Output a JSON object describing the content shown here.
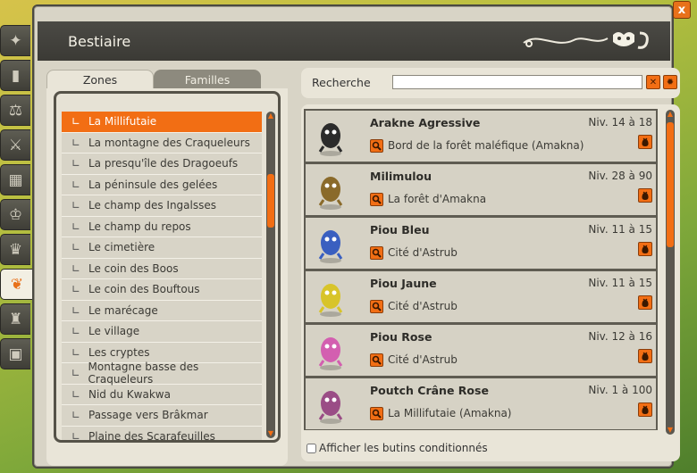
{
  "window": {
    "title": "Bestiaire",
    "close_label": "x"
  },
  "side_tabs": [
    {
      "icon": "wand-icon",
      "glyph": "✦"
    },
    {
      "icon": "book-icon",
      "glyph": "▮"
    },
    {
      "icon": "scales-icon",
      "glyph": "⚖"
    },
    {
      "icon": "crossed-axes-icon",
      "glyph": "⚔"
    },
    {
      "icon": "calendar-icon",
      "glyph": "▦"
    },
    {
      "icon": "trophy-icon",
      "glyph": "♔"
    },
    {
      "icon": "crown-icon",
      "glyph": "♛"
    },
    {
      "icon": "monster-head-icon",
      "glyph": "❦",
      "active": true
    },
    {
      "icon": "horned-helmet-icon",
      "glyph": "♜"
    },
    {
      "icon": "padlock-book-icon",
      "glyph": "▣"
    }
  ],
  "tabs": {
    "zones": "Zones",
    "families": "Familles"
  },
  "zones": [
    "La Millifutaie",
    "La montagne des Craqueleurs",
    "La presqu'île des Dragoeufs",
    "La péninsule des gelées",
    "Le champ des Ingalsses",
    "Le champ du repos",
    "Le cimetière",
    "Le coin des Boos",
    "Le coin des Bouftous",
    "Le marécage",
    "Le village",
    "Les cryptes",
    "Montagne basse des Craqueleurs",
    "Nid du Kwakwa",
    "Passage vers Brâkmar",
    "Plaine des Scarafeuilles"
  ],
  "selected_zone": 0,
  "search": {
    "label": "Recherche",
    "value": "",
    "clear_icon": "close-icon",
    "settings_icon": "gear-icon"
  },
  "monsters": [
    {
      "name": "Arakne Agressive",
      "level": "Niv. 14 à 18",
      "location": "Bord de la forêt maléfique (Amakna)",
      "color": "#2b2b2b"
    },
    {
      "name": "Milimulou",
      "level": "Niv. 28 à 90",
      "location": "La forêt d'Amakna",
      "color": "#8a6a2a"
    },
    {
      "name": "Piou Bleu",
      "level": "Niv. 11 à 15",
      "location": "Cité d'Astrub",
      "color": "#3a5fc0"
    },
    {
      "name": "Piou Jaune",
      "level": "Niv. 11 à 15",
      "location": "Cité d'Astrub",
      "color": "#d8c42a"
    },
    {
      "name": "Piou Rose",
      "level": "Niv. 12 à 16",
      "location": "Cité d'Astrub",
      "color": "#d35fb0"
    },
    {
      "name": "Poutch Crâne Rose",
      "level": "Niv. 1 à 100",
      "location": "La Millifutaie (Amakna)",
      "color": "#9a4d86"
    }
  ],
  "conditional_loot": {
    "label": "Afficher les butins conditionnés",
    "checked": false
  },
  "colors": {
    "accent": "#f26e14",
    "title_bar": "#3b3a35",
    "panel": "#e9e5d8"
  }
}
